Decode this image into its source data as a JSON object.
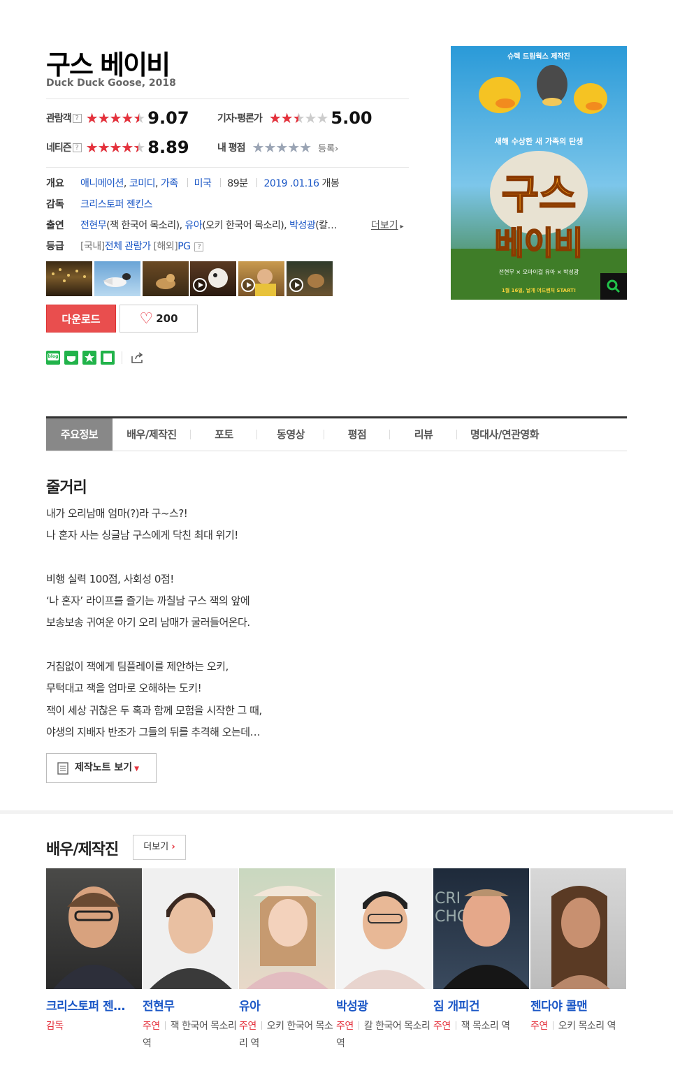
{
  "movie": {
    "title": "구스 베이비",
    "subtitle": "Duck Duck Goose, 2018"
  },
  "ratings": {
    "audience": {
      "label": "관람객",
      "help": "?",
      "stars": "★★★★★",
      "fill": 0.907,
      "score": "9.07"
    },
    "critic": {
      "label": "기자·평론가",
      "stars": "★★★★★",
      "fill": 0.5,
      "score": "5.00"
    },
    "netizen": {
      "label": "네티즌",
      "help": "?",
      "stars": "★★★★★",
      "fill": 0.889,
      "score": "8.89"
    },
    "mine": {
      "label": "내 평점",
      "stars": "★★★★★",
      "register": "등록",
      "arrow": "›"
    }
  },
  "info": {
    "summary_label": "개요",
    "genres": [
      "애니메이션",
      "코미디",
      "가족"
    ],
    "country": "미국",
    "runtime": "89분",
    "release_date": "2019 .01.16",
    "release_suffix": "개봉",
    "director_label": "감독",
    "director": "크리스토퍼 젠킨스",
    "cast_label": "출연",
    "cast": [
      {
        "name": "전현무",
        "note": "(잭 한국어 목소리),"
      },
      {
        "name": "유아",
        "note": "(오키 한국어 목소리),"
      },
      {
        "name": "박성광",
        "note": "(칼…"
      }
    ],
    "cast_more": "더보기",
    "cast_more_arrow": "▸",
    "grade_label": "등급",
    "grade_domestic_prefix": "[국내]",
    "grade_domestic": "전체 관람가",
    "grade_foreign_prefix": "[해외]",
    "grade_foreign": "PG",
    "grade_help": "?"
  },
  "actions": {
    "download": "다운로드",
    "like_icon": "heart-icon",
    "like_count": "200"
  },
  "share": {
    "blog_label": "blog"
  },
  "colors": {
    "accent_red": "#e5313c",
    "link_blue": "#1b57c6",
    "download_bg": "#e94e4e",
    "naver_green": "#21b34a"
  },
  "tabs": [
    "주요정보",
    "배우/제작진",
    "포토",
    "동영상",
    "평점",
    "리뷰",
    "명대사/연관영화"
  ],
  "plot": {
    "heading": "줄거리",
    "lines": [
      "내가 오리남매 엄마(?)라 구~스?!",
      " 나 혼자 사는 싱글남 구스에게 닥친 최대 위기!",
      "",
      " 비행 실력 100점, 사회성 0점!",
      " ‘나 혼자’ 라이프를 즐기는 까칠남 구스 잭의 앞에",
      " 보송보송 귀여운 아기 오리 남매가 굴러들어온다.",
      "",
      " 거침없이 잭에게 팀플레이를 제안하는 오키,",
      " 무턱대고 잭을 엄마로 오해하는 도키!",
      " 잭이 세상 귀찮은 두 혹과 함께 모험을 시작한 그 때,",
      " 야생의 지배자 반조가 그들의 뒤를 추격해 오는데…"
    ],
    "note_button": "제작노트 보기"
  },
  "cast_section": {
    "heading": "배우/제작진",
    "more": "더보기",
    "people": [
      {
        "name": "크리스토퍼 젠…",
        "role": "감독",
        "desc": ""
      },
      {
        "name": "전현무",
        "role": "주연",
        "desc": "잭 한국어 목소리 역"
      },
      {
        "name": "유아",
        "role": "주연",
        "desc": "오키 한국어 목소리 역"
      },
      {
        "name": "박성광",
        "role": "주연",
        "desc": "칼 한국어 목소리 역"
      },
      {
        "name": "짐 개피건",
        "role": "주연",
        "desc": "잭 목소리 역"
      },
      {
        "name": "젠다야 콜맨",
        "role": "주연",
        "desc": "오키 목소리 역"
      }
    ]
  },
  "poster": {
    "top_text": "슈렉 드림웍스 제작진",
    "tagline": "새해 수상한 새 가족의 탄생",
    "title_line1": "구스",
    "title_line2": "베이비",
    "credits": "전현무 × 오마이걸 유아 × 박성광",
    "release": "1월 16일, 날개 어드벤처 START!"
  }
}
